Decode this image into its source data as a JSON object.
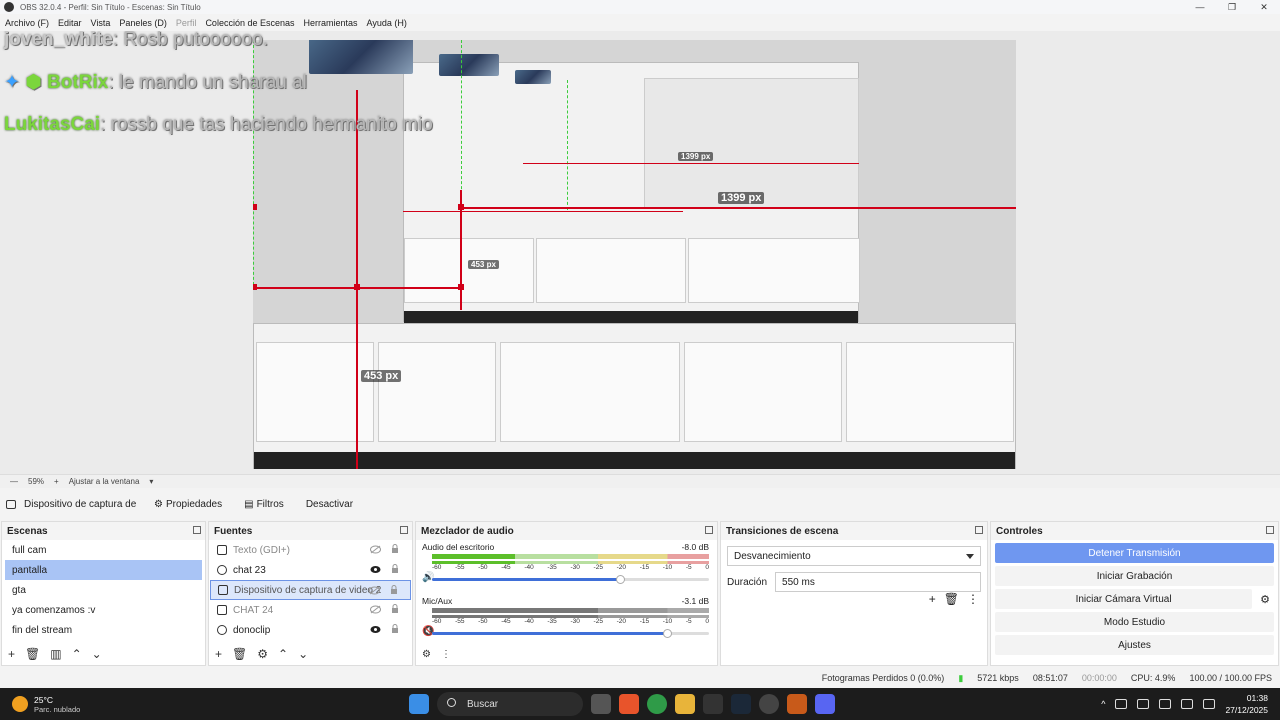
{
  "window": {
    "title": "OBS 32.0.4 - Perfil: Sin Título - Escenas: Sin Título",
    "controls": [
      "—",
      "❐",
      "✕"
    ]
  },
  "menu": [
    "Archivo (F)",
    "Editar",
    "Vista",
    "Paneles (D)",
    "Perfil",
    "Colección de Escenas",
    "Herramientas",
    "Ayuda (H)"
  ],
  "preview": {
    "chat": [
      {
        "user": "joven_white",
        "msg": "Rosb putoooooo."
      },
      {
        "user": "BotRix",
        "msg": "le mando un sharau al"
      },
      {
        "user": "LukitasCai",
        "msg": "rossb que tas haciendo hermanito mio"
      }
    ],
    "dimension_labels": [
      "453 px",
      "1399 px",
      "453 px",
      "1399 px"
    ]
  },
  "zoom": {
    "level": "59%",
    "fit_label": "Ajustar a la ventana"
  },
  "source_toolbar": {
    "source_name": "Dispositivo de captura de v",
    "properties": "Propiedades",
    "filters": "Filtros",
    "deactivate": "Desactivar"
  },
  "scenes": {
    "title": "Escenas",
    "items": [
      "full cam",
      "pantalla",
      "gta",
      "ya comenzamos :v",
      "fin del stream"
    ],
    "selected_index": 1
  },
  "sources": {
    "title": "Fuentes",
    "items": [
      {
        "name": "Texto (GDI+)",
        "icon": "text-icon",
        "visible": false
      },
      {
        "name": "chat 23",
        "icon": "globe-icon",
        "visible": true
      },
      {
        "name": "Dispositivo de captura de video 2",
        "icon": "camera-icon",
        "visible": false
      },
      {
        "name": "CHAT 24",
        "icon": "window-icon",
        "visible": false
      },
      {
        "name": "donoclip",
        "icon": "globe-icon",
        "visible": true
      }
    ]
  },
  "mixer": {
    "title": "Mezclador de audio",
    "channels": [
      {
        "name": "Audio del escritorio",
        "db": "-8.0 dB",
        "level_percent": 30,
        "volume_percent": 68,
        "muted": false
      },
      {
        "name": "Mic/Aux",
        "db": "-3.1 dB",
        "level_percent": 0,
        "volume_percent": 85,
        "muted": true
      }
    ],
    "ticks": [
      "-60",
      "-55",
      "-50",
      "-45",
      "-40",
      "-35",
      "-30",
      "-25",
      "-20",
      "-15",
      "-10",
      "-5",
      "0"
    ]
  },
  "transitions": {
    "title": "Transiciones de escena",
    "selected": "Desvanecimiento",
    "duration_label": "Duración",
    "duration_value": "550 ms"
  },
  "controls": {
    "title": "Controles",
    "buttons": [
      "Detener Transmisión",
      "Iniciar Grabación",
      "Iniciar Cámara Virtual",
      "Modo Estudio",
      "Ajustes"
    ]
  },
  "status": {
    "dropped": "Fotogramas Perdidos 0 (0.0%)",
    "bitrate": "5721 kbps",
    "stream_time": "08:51:07",
    "rec_time": "00:00:00",
    "cpu": "CPU: 4.9%",
    "fps": "100.00 / 100.00 FPS"
  },
  "taskbar": {
    "temp": "25°C",
    "weather": "Parc. nublado",
    "search": "Buscar",
    "time": "01:38",
    "date": "27/12/2025"
  },
  "colors": {
    "accent": "#6f97f0",
    "selection": "#a9c4f5",
    "guide_red": "#d10018",
    "guide_green": "#3ccc3c"
  }
}
